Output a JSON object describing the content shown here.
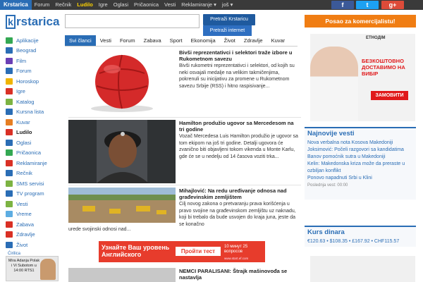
{
  "topbar": {
    "brand": "Krstarica",
    "items": [
      {
        "label": "Forum",
        "active": false
      },
      {
        "label": "Rečnik",
        "active": false
      },
      {
        "label": "Ludilo",
        "active": true
      },
      {
        "label": "Igre",
        "active": false
      },
      {
        "label": "Oglasi",
        "active": false
      },
      {
        "label": "Pričaonica",
        "active": false
      },
      {
        "label": "Vesti",
        "active": false
      },
      {
        "label": "Reklamiranje ▾",
        "active": false
      },
      {
        "label": "još ▾",
        "active": false
      }
    ],
    "social": {
      "facebook": "f",
      "twitter": "t",
      "google": "g+"
    }
  },
  "header": {
    "logo_k": "k",
    "logo_rest": "rstarica",
    "search_placeholder": "",
    "search_button": "Pretraži Krstaricu",
    "search_internet_button": "Pretraži internet",
    "promo": "Posao za komercijalistu!"
  },
  "sidebar": {
    "items": [
      {
        "label": "Aplikacije",
        "icon": "phone-icon",
        "color": "#34a853",
        "bold": false
      },
      {
        "label": "Beograd",
        "icon": "building-icon",
        "color": "#2a6db5",
        "bold": false
      },
      {
        "label": "Film",
        "icon": "film-icon",
        "color": "#6a3fb5",
        "bold": false
      },
      {
        "label": "Forum",
        "icon": "forum-icon",
        "color": "#2a6db5",
        "bold": false
      },
      {
        "label": "Horoskop",
        "icon": "horoscope-icon",
        "color": "#f0b400",
        "bold": false
      },
      {
        "label": "Igre",
        "icon": "gamepad-icon",
        "color": "#d93025",
        "bold": false
      },
      {
        "label": "Katalog",
        "icon": "catalog-icon",
        "color": "#7cb342",
        "bold": false
      },
      {
        "label": "Kursna lista",
        "icon": "currency-icon",
        "color": "#2a6db5",
        "bold": false
      },
      {
        "label": "Kuvar",
        "icon": "cook-icon",
        "color": "#e67e22",
        "bold": false
      },
      {
        "label": "Ludilo",
        "icon": "smile-icon",
        "color": "#d93025",
        "bold": true
      },
      {
        "label": "Oglasi",
        "icon": "ads-icon",
        "color": "#2a6db5",
        "bold": false
      },
      {
        "label": "Pričaonica",
        "icon": "chat-icon",
        "color": "#34a853",
        "bold": false
      },
      {
        "label": "Reklamiranje",
        "icon": "megaphone-icon",
        "color": "#d93025",
        "bold": false
      },
      {
        "label": "Rečnik",
        "icon": "dictionary-icon",
        "color": "#2a6db5",
        "bold": false
      },
      {
        "label": "SMS servisi",
        "icon": "sms-icon",
        "color": "#7cb342",
        "bold": false
      },
      {
        "label": "TV program",
        "icon": "tv-icon",
        "color": "#2a6db5",
        "bold": false
      },
      {
        "label": "Vesti",
        "icon": "news-icon",
        "color": "#7cb342",
        "bold": false
      },
      {
        "label": "Vreme",
        "icon": "weather-icon",
        "color": "#5dade2",
        "bold": false
      },
      {
        "label": "Zabava",
        "icon": "heart-icon",
        "color": "#d93025",
        "bold": false
      },
      {
        "label": "Zdravlje",
        "icon": "health-icon",
        "color": "#d93025",
        "bold": false
      },
      {
        "label": "Život",
        "icon": "life-icon",
        "color": "#2a6db5",
        "bold": false
      }
    ],
    "latin": "Ćirilica",
    "ad_text": "Mira Adanja Polak i Vi Subotom u 14:00 RTS1"
  },
  "tabs": [
    {
      "label": "Svi članci",
      "active": true
    },
    {
      "label": "Vesti",
      "active": false
    },
    {
      "label": "Forum",
      "active": false
    },
    {
      "label": "Zabava",
      "active": false
    },
    {
      "label": "Sport",
      "active": false
    },
    {
      "label": "Ekonomija",
      "active": false
    },
    {
      "label": "Život",
      "active": false
    },
    {
      "label": "Zdravlje",
      "active": false
    },
    {
      "label": "Kuvar",
      "active": false
    }
  ],
  "articles": [
    {
      "title": "Bivši reprezentativci i selektori traže izbore u Rukometnom savezu",
      "text": "Bivši rukometni reprezentativci i selektori, od kojih su neki osvajali medalje na velikim takmičenjima, pokrenuli su inicijativu za promene u Rukometnom savezu Srbije (RSS) i hitno raspisivanje..."
    },
    {
      "title": "Hamilton produžio ugovor sa Mercedesom na tri godine",
      "text": "Vozač Mercedesa Luis Hamilton produžio je ugovor sa tom ekipom na još tri godine. Detalji ugovora će zvanično biti objavljeni tokom vikenda u Monte Karlu, gde će se u nedelju od 14 časova voziti trka..."
    },
    {
      "title": "Mihajlović: Na redu uređivanje odnosa nad građevinskim zemljištem",
      "text": "Cilj novog zakona o pretvaranju prava korišćenja u pravo svojine na građevinskom zemljištu uz naknadu, koji bi trebalo da bude usvojen do kraja juna, jeste da se konačno",
      "text_tail": "urede svojinski odnosi nad..."
    },
    {
      "title": "NEMCI PARALISANI: Štrajk mašinovođa se nastavlja",
      "text": ""
    }
  ],
  "banner": {
    "headline": "Узнайте Ваш уровень Английского",
    "cta": "Пройти тест",
    "note": "10 минут 25 вопросов",
    "url": "www.start.ef.com"
  },
  "right_ad": {
    "logo": "ЕТНОДІМ",
    "headline": "БЕЗКОШТОВНО ДОСТАВИМО НА ВИБІР",
    "cta": "ЗАМОВИТИ"
  },
  "news_panel": {
    "title": "Najnovije vesti",
    "items": [
      "Nova verbalna nota Kosova Makedoniji",
      "Joksimović: Počeli razgovori sa kandidatima",
      "Banov pomoćnik sutra u Makedoniji",
      "Kelin: Makedonska kriza može da preraste u",
      "ozbiljan konflikt",
      "Ponovo napadnuti Srbi u Klini"
    ],
    "updated_label": "Poslednja vest: 00:00"
  },
  "rate_panel": {
    "title": "Kurs dinara",
    "rates": "€120.63 • $108.35 • £167.92 • CHF115.57"
  }
}
